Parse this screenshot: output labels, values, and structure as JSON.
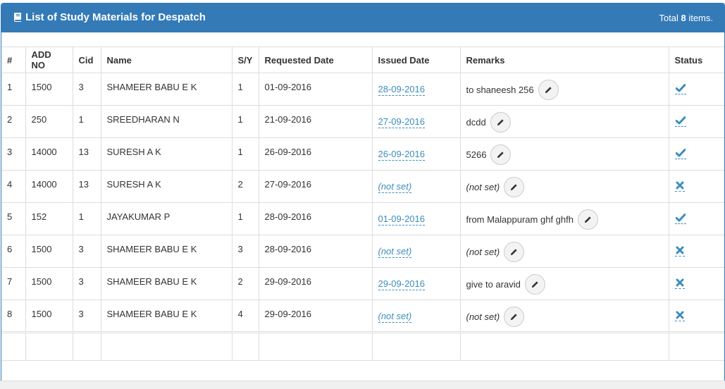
{
  "panel": {
    "title": "List of Study Materials for Despatch",
    "summary_prefix": "Total",
    "summary_count": "8",
    "summary_suffix": "items."
  },
  "columns": [
    "#",
    "ADD NO",
    "Cid",
    "Name",
    "S/Y",
    "Requested Date",
    "Issued Date",
    "Remarks",
    "Status"
  ],
  "rows": [
    {
      "num": "1",
      "add_no": "1500",
      "cid": "3",
      "name": "SHAMEER BABU E K",
      "sy": "1",
      "requested": "01-09-2016",
      "issued": "28-09-2016",
      "remarks": "to shaneesh 256",
      "status": "check"
    },
    {
      "num": "2",
      "add_no": "250",
      "cid": "1",
      "name": "SREEDHARAN N",
      "sy": "1",
      "requested": "21-09-2016",
      "issued": "27-09-2016",
      "remarks": "dcdd",
      "status": "check"
    },
    {
      "num": "3",
      "add_no": "14000",
      "cid": "13",
      "name": "SURESH A K",
      "sy": "1",
      "requested": "26-09-2016",
      "issued": "26-09-2016",
      "remarks": "5266",
      "status": "check"
    },
    {
      "num": "4",
      "add_no": "14000",
      "cid": "13",
      "name": "SURESH A K",
      "sy": "2",
      "requested": "27-09-2016",
      "issued": "(not set)",
      "remarks": "(not set)",
      "status": "cross"
    },
    {
      "num": "5",
      "add_no": "152",
      "cid": "1",
      "name": "JAYAKUMAR P",
      "sy": "1",
      "requested": "28-09-2016",
      "issued": "01-09-2016",
      "remarks": "from Malappuram ghf ghfh",
      "status": "check"
    },
    {
      "num": "6",
      "add_no": "1500",
      "cid": "3",
      "name": "SHAMEER BABU E K",
      "sy": "3",
      "requested": "28-09-2016",
      "issued": "(not set)",
      "remarks": "(not set)",
      "status": "cross"
    },
    {
      "num": "7",
      "add_no": "1500",
      "cid": "3",
      "name": "SHAMEER BABU E K",
      "sy": "2",
      "requested": "29-09-2016",
      "issued": "29-09-2016",
      "remarks": "give to aravid",
      "status": "cross"
    },
    {
      "num": "8",
      "add_no": "1500",
      "cid": "3",
      "name": "SHAMEER BABU E K",
      "sy": "4",
      "requested": "29-09-2016",
      "issued": "(not set)",
      "remarks": "(not set)",
      "status": "cross"
    }
  ],
  "icons": {
    "title": "book-icon",
    "edit": "pencil-icon",
    "status_true": "check-icon",
    "status_false": "cross-icon"
  },
  "colors": {
    "heading": "#337ab7",
    "link": "#3c8dbc"
  }
}
